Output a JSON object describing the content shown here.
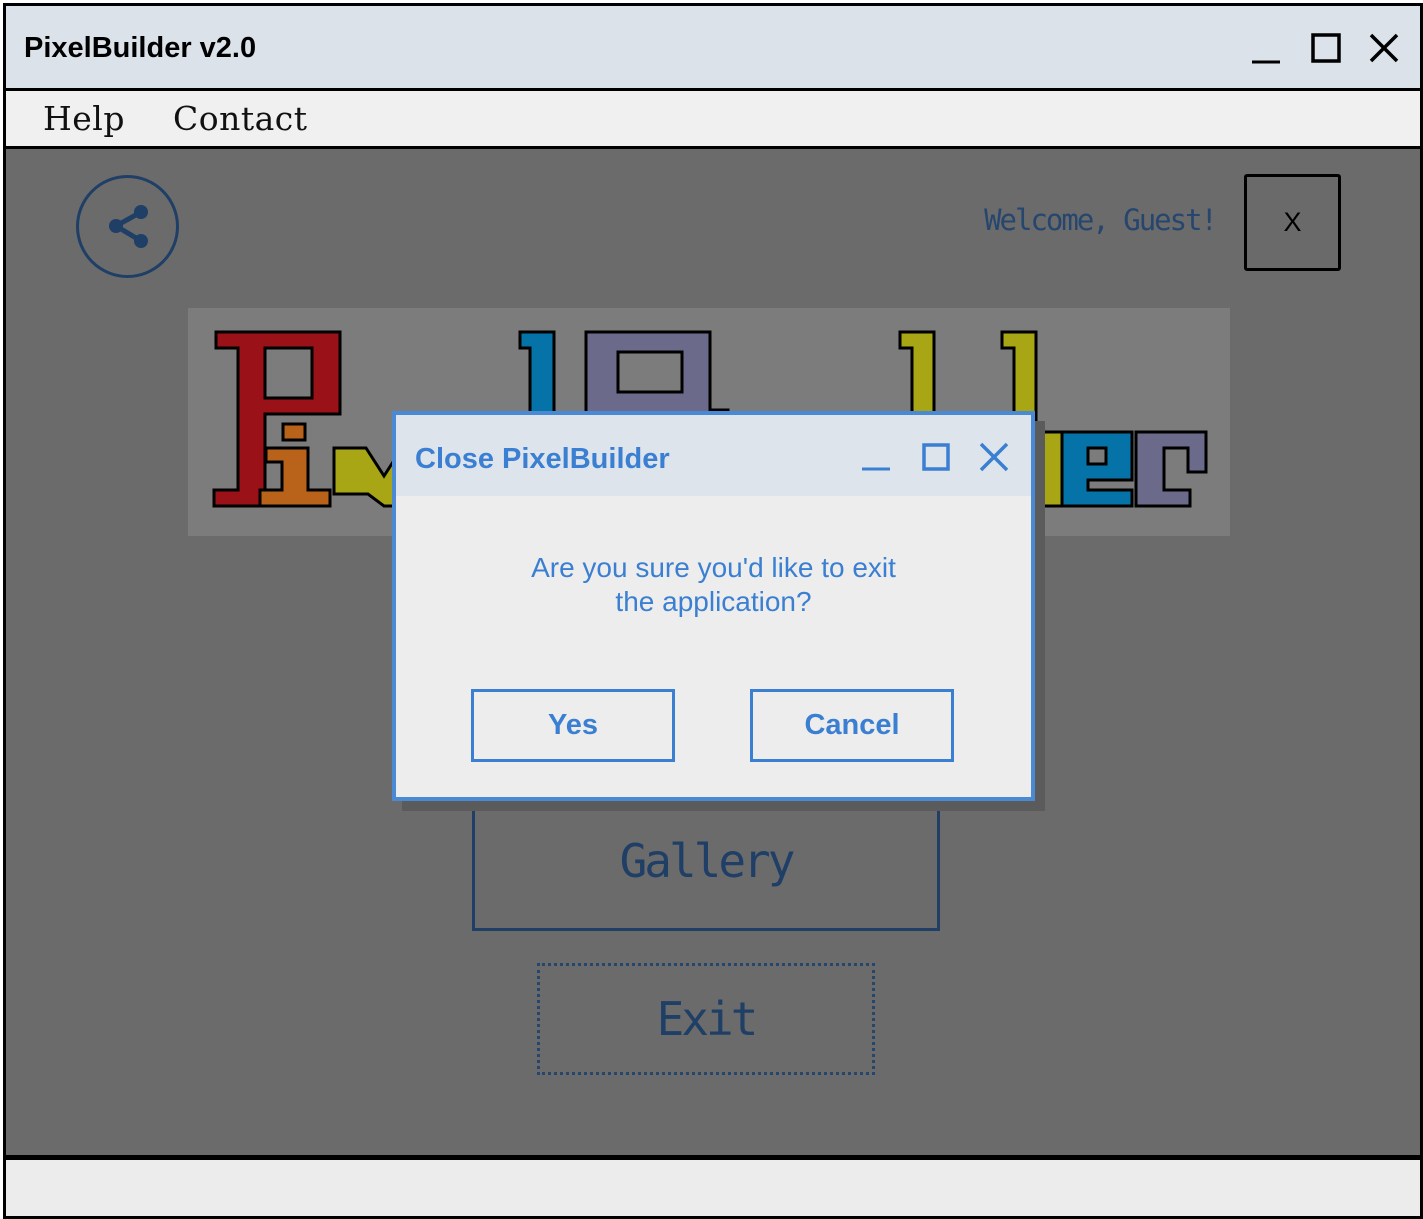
{
  "window": {
    "title": "PixelBuilder v2.0",
    "controls": [
      "minimize-icon",
      "maximize-icon",
      "close-icon"
    ]
  },
  "menu": {
    "items": [
      {
        "label": "Help"
      },
      {
        "label": "Contact"
      }
    ]
  },
  "main": {
    "share_icon": "share-icon",
    "welcome_text": "Welcome, Guest!",
    "close_label": "X",
    "logo_text": "PixelBuilder",
    "buttons": {
      "gallery": "Gallery",
      "exit": "Exit"
    }
  },
  "dialog": {
    "title": "Close PixelBuilder",
    "message_line1": "Are you sure you'd like to exit",
    "message_line2": "the application?",
    "yes_label": "Yes",
    "cancel_label": "Cancel"
  },
  "colors": {
    "dialog_accent": "#3a7fd1",
    "overlay": "#6b6b6b",
    "titlebar": "#dbe2ea",
    "logo_red": "#9b1118",
    "logo_orange": "#b8621a",
    "logo_olive": "#a8a614",
    "logo_blue": "#0573a8",
    "logo_purple": "#6b6a8a"
  }
}
